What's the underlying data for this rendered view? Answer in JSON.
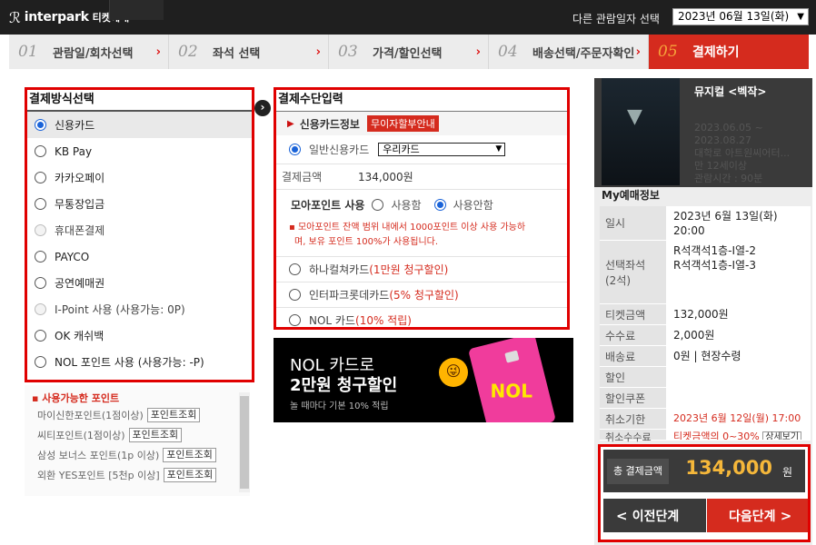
{
  "header": {
    "logo_text": "interpark",
    "logo_sub": "티켓예매",
    "date_label": "다른 관람일자 선택",
    "date_value": "2023년 06월 13일(화)"
  },
  "steps": [
    {
      "num": "01",
      "label": "관람일/회차선택"
    },
    {
      "num": "02",
      "label": "좌석 선택"
    },
    {
      "num": "03",
      "label": "가격/할인선택"
    },
    {
      "num": "04",
      "label": "배송선택/주문자확인"
    },
    {
      "num": "05",
      "label": "결제하기"
    }
  ],
  "methods": {
    "title": "결제방식선택",
    "items": [
      {
        "label": "신용카드"
      },
      {
        "label": "KB Pay"
      },
      {
        "label": "카카오페이"
      },
      {
        "label": "무통장입금"
      },
      {
        "label": "휴대폰결제"
      },
      {
        "label": "PAYCO"
      },
      {
        "label": "공연예매권"
      },
      {
        "label": "I-Point 사용 (사용가능: 0P)"
      },
      {
        "label": "OK 캐쉬백"
      },
      {
        "label": "NOL 포인트 사용 (사용가능: -P)"
      }
    ]
  },
  "points": {
    "title": "사용가능한 포인트",
    "button_label": "포인트조회",
    "items": [
      {
        "label": "마이신한포인트(1점이상)"
      },
      {
        "label": "씨티포인트(1점이상)"
      },
      {
        "label": "삼성 보너스 포인트(1p 이상)"
      },
      {
        "label": "외환 YES포인트 [5천p 이상]"
      }
    ]
  },
  "payment": {
    "title": "결제수단입력",
    "card_info_label": "신용카드정보",
    "installment_tag": "무이자할부안내",
    "general_card_label": "일반신용카드",
    "card_select": "우리카드",
    "amount_label": "결제금액",
    "amount_value": "134,000원",
    "moa_label": "모아포인트 사용",
    "moa_use": "사용함",
    "moa_nouse": "사용안함",
    "notice_line1": "모아포인트 잔액 범위 내에서 1000포인트 이상 사용 가능하",
    "notice_line2": "며, 보유 포인트 100%가 사용됩니다.",
    "discounts": [
      {
        "name": "하나컬쳐카드 ",
        "benefit": "(1만원 청구할인)"
      },
      {
        "name": "인터파크롯데카드 ",
        "benefit": "(5% 청구할인)"
      },
      {
        "name": "NOL 카드 ",
        "benefit": "(10% 적립)"
      }
    ]
  },
  "banner": {
    "line1": "NOL 카드로",
    "line2": "2만원 청구할인",
    "line3": "놀 때마다 기본 10% 적립",
    "card_text": "NOL"
  },
  "show": {
    "title": "뮤지컬 <벡작>",
    "period_line1": "2023.06.05 ~",
    "period_line2": "2023.08.27",
    "venue": "대학로 아트원씨어터...",
    "age": "만 12세이상",
    "runtime": "관람시간 : 90분"
  },
  "my_booking": {
    "title": "My예매정보",
    "rows": [
      {
        "key": "일시",
        "val1": "2023년 6월 13일(화)",
        "val2": "20:00"
      },
      {
        "key": "선택좌석",
        "key2": "(2석)",
        "val1": "R석객석1층-I열-2",
        "val2": "R석객석1층-I열-3"
      },
      {
        "key": "티켓금액",
        "val1": "132,000원"
      },
      {
        "key": "수수료",
        "val1": "2,000원"
      },
      {
        "key": "배송료",
        "val1": "0원 | 현장수령"
      },
      {
        "key": "할인",
        "val1": ""
      },
      {
        "key": "할인쿠폰",
        "val1": ""
      },
      {
        "key": "취소기한",
        "val1": "2023년 6월 12일(월) 17:00"
      },
      {
        "key": "취소수수료",
        "val1": "티켓금액의 0~30%",
        "btn": "상세보기"
      }
    ]
  },
  "total": {
    "label": "총 결제금액",
    "value": "134,000",
    "unit": "원"
  },
  "nav": {
    "prev_label": "이전단계",
    "next_label": "다음단계"
  },
  "colors": {
    "accent": "#d52b1e",
    "highlight_border": "#e00000",
    "total_value": "#f5b73a"
  }
}
